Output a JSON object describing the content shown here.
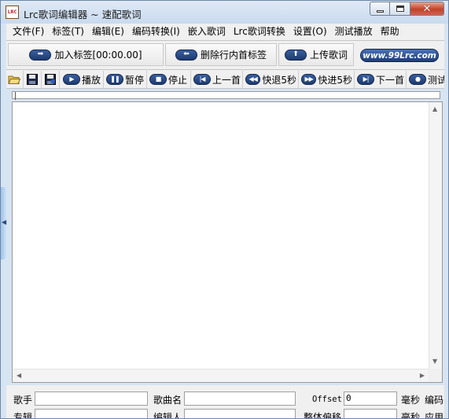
{
  "window": {
    "app_icon_text": "LRC",
    "title": "Lrc歌词编辑器 ~ 速配歌词"
  },
  "menu": [
    {
      "label": "文件(F)"
    },
    {
      "label": "标签(T)"
    },
    {
      "label": "编辑(E)"
    },
    {
      "label": "编码转换(I)"
    },
    {
      "label": "嵌入歌词"
    },
    {
      "label": "Lrc歌词转换"
    },
    {
      "label": "设置(O)"
    },
    {
      "label": "测试播放"
    },
    {
      "label": "帮助"
    }
  ],
  "big_buttons": {
    "add_tag": "加入标签[00:00.00]",
    "delete_line_tag": "删除行内首标签",
    "upload_lyrics": "上传歌词",
    "site_link": "www.99Lrc.com"
  },
  "toolbar": {
    "play": "播放",
    "pause": "暂停",
    "stop": "停止",
    "prev": "上一首",
    "rewind": "快退5秒",
    "forward": "快进5秒",
    "next": "下一首",
    "test": "测试"
  },
  "fields": {
    "singer_label": "歌手",
    "singer_value": "",
    "song_label": "歌曲名",
    "song_value": "",
    "offset_label": "Offset",
    "offset_value": "0",
    "ms_label_1": "毫秒",
    "encoding_label": "编码",
    "album_label": "专辑",
    "album_value": "",
    "editor_label": "编辑人",
    "editor_value": "",
    "global_offset_label": "整体偏移",
    "global_offset_value": "",
    "ms_label_2": "毫秒",
    "apply_label": "应用"
  },
  "colors": {
    "title_bar": "#c9daee",
    "button_pill": "#1d3a70",
    "close_button": "#c4412b"
  }
}
